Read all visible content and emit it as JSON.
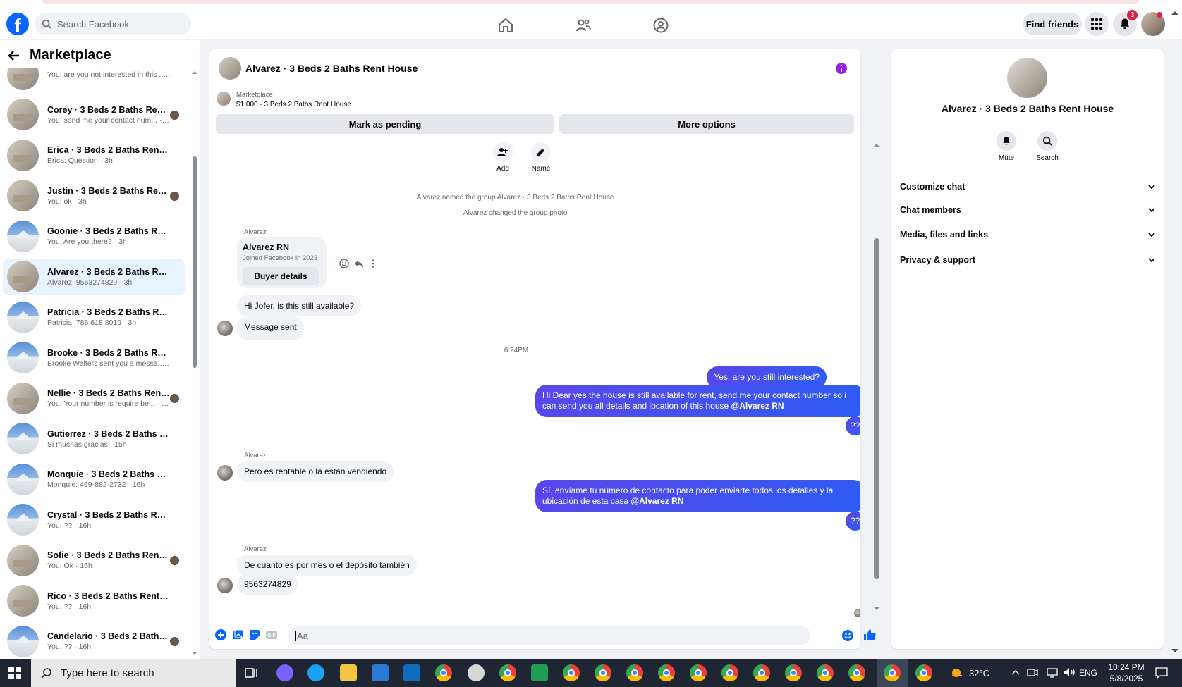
{
  "topbar": {
    "search_placeholder": "Search Facebook",
    "find_friends": "Find friends",
    "notification_count": "3"
  },
  "left": {
    "title": "Marketplace",
    "conversations": [
      {
        "name": "",
        "preview": "You: are you not interested in this ... · 1h",
        "thumb": "room",
        "read": false
      },
      {
        "name": "Corey · 3 Beds 2 Baths Rent H...",
        "preview": "You: send me your contact num... · 1h",
        "thumb": "room",
        "read": true
      },
      {
        "name": "Erica · 3 Beds 2 Baths Rent House",
        "preview": "Erica: Question · 3h",
        "thumb": "room",
        "read": false
      },
      {
        "name": "Justin · 3 Beds 2 Baths Rent H...",
        "preview": "You: ok · 3h",
        "thumb": "room",
        "read": true
      },
      {
        "name": "Goonie · 3 Beds 2 Baths Rent H...",
        "preview": "You: Are you there? · 3h",
        "thumb": "house",
        "read": false
      },
      {
        "name": "Alvarez · 3 Beds 2 Baths Rent H...",
        "preview": "Alvarez: 9563274829 · 3h",
        "thumb": "room",
        "read": false,
        "active": true
      },
      {
        "name": "Patricia · 3 Beds 2 Baths Rent H...",
        "preview": "Patricia: 786 618 8019 · 3h",
        "thumb": "house",
        "read": false
      },
      {
        "name": "Brooke · 3 Beds 2 Baths Rent H...",
        "preview": "Brooke Walters sent you a messa... · 12h",
        "thumb": "house",
        "read": false
      },
      {
        "name": "Nellie · 3 Beds 2 Baths Rent H...",
        "preview": "You: Your number is require be... · 15h",
        "thumb": "room",
        "read": true
      },
      {
        "name": "Gutierrez · 3 Beds 2 Baths Rent ...",
        "preview": "Si muchas gracias · 15h",
        "thumb": "house",
        "read": false
      },
      {
        "name": "Monquie · 3 Beds 2 Baths Rent ...",
        "preview": "Monquie: 469-882-2732 · 16h",
        "thumb": "house",
        "read": false
      },
      {
        "name": "Crystal · 3 Beds 2 Baths Rent Ho...",
        "preview": "You: ?? · 16h",
        "thumb": "house",
        "read": false
      },
      {
        "name": "Sofie · 3 Beds 2 Baths Rent H...",
        "preview": "You: Ok · 16h",
        "thumb": "room",
        "read": true
      },
      {
        "name": "Rico · 3 Beds 2 Baths Rent House",
        "preview": "You: ?? · 16h",
        "thumb": "room",
        "read": false
      },
      {
        "name": "Candelario · 3 Beds 2 Baths R...",
        "preview": "You: ?? · 16h",
        "thumb": "house",
        "read": true
      }
    ]
  },
  "chat": {
    "title": "Alvarez · 3 Beds 2 Baths Rent House",
    "mp_label": "Marketplace",
    "mp_listing": "$1,000 - 3 Beds 2 Baths Rent House",
    "mark_pending": "Mark as pending",
    "more_options": "More options",
    "add_label": "Add",
    "name_label": "Name",
    "sys1": "Alvarez named the group Alvarez · 3 Beds 2 Baths Rent House.",
    "sys2": "Alvarez changed the group photo.",
    "sender": "Alvarez",
    "card_name": "Alvarez RN",
    "card_joined": "Joined Facebook in 2023",
    "buyer_details": "Buyer details",
    "in1": "Hi Jofer, is this still available?",
    "in2": "Message sent",
    "time": "6:24PM",
    "out1": "Yes, are you still interested?",
    "out2_text": "Hi Dear yes the house is still available for rent, send me your contact number so i can send you all details and location of this house ",
    "out2_mention": "@Alvarez RN",
    "out3": "??",
    "in3": "Pero es rentable o la están vendiendo",
    "out4_text": "Sí, envíame tu número de contacto para poder enviarte todos los detalles y la ubicación de esta casa ",
    "out4_mention": "@Alvarez RN",
    "out5": "??",
    "in4": "De cuanto es por mes o el depósito también",
    "in5": "9563274829",
    "composer_placeholder": "Aa"
  },
  "right": {
    "title": "Alvarez · 3 Beds 2 Baths Rent House",
    "mute": "Mute",
    "search": "Search",
    "sections": [
      "Customize chat",
      "Chat members",
      "Media, files and links",
      "Privacy & support"
    ]
  },
  "taskbar": {
    "search_placeholder": "Type here to search",
    "weather": "32°C",
    "language": "ENG",
    "time": "10:24 PM",
    "date": "5/8/2025"
  }
}
